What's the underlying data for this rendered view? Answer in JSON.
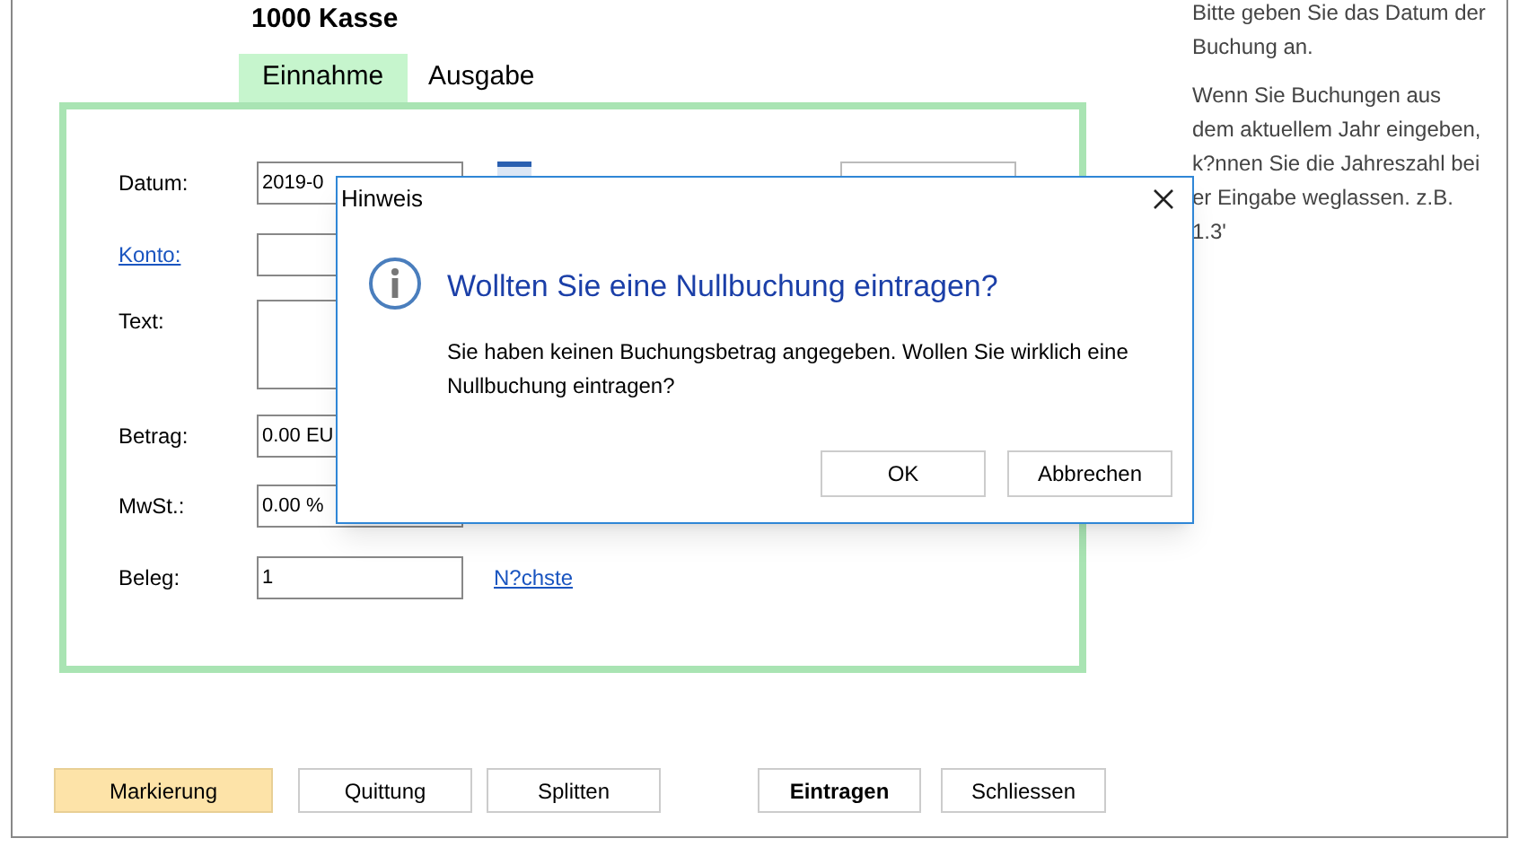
{
  "window": {
    "title": "1000 Kasse"
  },
  "tabs": [
    {
      "label": "Einnahme",
      "selected": true
    },
    {
      "label": "Ausgabe",
      "selected": false
    }
  ],
  "form": [
    {
      "label": "Datum:",
      "kind": "text",
      "value": "2019-0",
      "link": false
    },
    {
      "label": "Konto:",
      "kind": "text",
      "link": true
    },
    {
      "label": "Text:",
      "kind": "area",
      "link": false
    },
    {
      "label": "Betrag:",
      "kind": "text",
      "value": "0.00 EU",
      "link": false
    },
    {
      "label": "MwSt.:",
      "kind": "text",
      "value": "0.00 %",
      "link": false
    },
    {
      "label": "Beleg:",
      "kind": "text",
      "value": "1",
      "link": false,
      "action": "N?chste"
    }
  ],
  "help": [
    "Bitte geben Sie das Datum der Buchung an.",
    "Wenn Sie Buchungen aus dem aktuellem Jahr eingeben, k?nnen Sie die Jahreszahl bei er Eingabe weglassen. z.B. 1.3'"
  ],
  "buttons": [
    {
      "label": "Markierung",
      "kind": "highlight"
    },
    {
      "label": "Quittung",
      "kind": "normal"
    },
    {
      "label": "Splitten",
      "kind": "normal"
    },
    {
      "label": "Eintragen",
      "kind": "default"
    },
    {
      "label": "Schliessen",
      "kind": "normal"
    }
  ],
  "dialog": {
    "title": "Hinweis",
    "heading": "Wollten Sie eine Nullbuchung eintragen?",
    "message": "Sie haben keinen Buchungsbetrag angegeben. Wollen Sie wirklich eine Nullbuchung eintragen?",
    "buttons": [
      "OK",
      "Abbrechen"
    ]
  }
}
